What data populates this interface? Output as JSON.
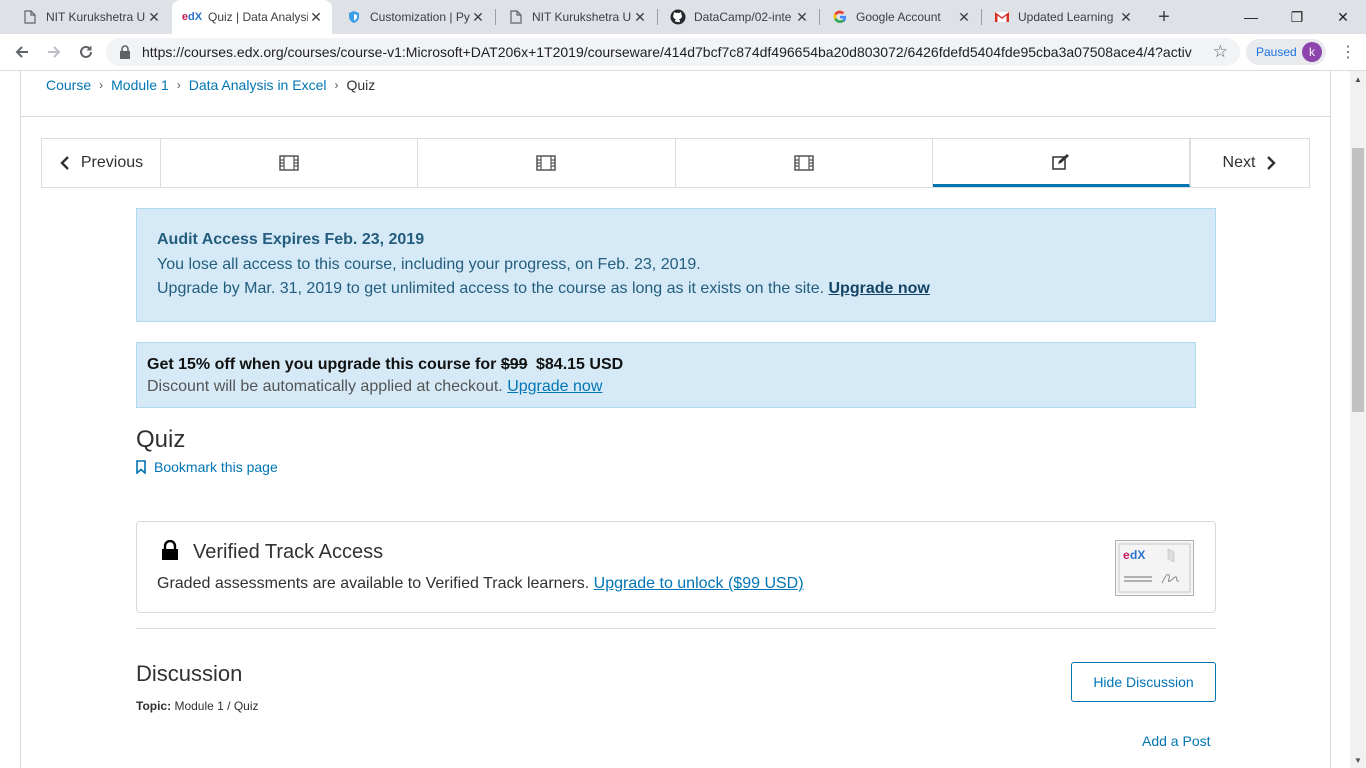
{
  "browser": {
    "tabs": [
      {
        "title": "NIT Kurukshetra U",
        "favicon": "page-icon",
        "active": false
      },
      {
        "title": "Quiz | Data Analysis",
        "favicon": "edx-icon",
        "active": true
      },
      {
        "title": "Customization | Py",
        "favicon": "shield-icon",
        "active": false
      },
      {
        "title": "NIT Kurukshetra U",
        "favicon": "page-icon",
        "active": false
      },
      {
        "title": "DataCamp/02-inte",
        "favicon": "github-icon",
        "active": false
      },
      {
        "title": "Google Account",
        "favicon": "google-icon",
        "active": false
      },
      {
        "title": "Updated Learning",
        "favicon": "gmail-icon",
        "active": false
      }
    ],
    "url": "https://courses.edx.org/courses/course-v1:Microsoft+DAT206x+1T2019/courseware/414d7bcf7c874df496654ba20d803072/6426fdefd5404fde95cba3a07508ace4/4?activ...",
    "profile_status": "Paused",
    "profile_initial": "k"
  },
  "breadcrumb": {
    "items": [
      "Course",
      "Module 1",
      "Data Analysis in Excel"
    ],
    "current": "Quiz"
  },
  "sequence_nav": {
    "previous_label": "Previous",
    "next_label": "Next",
    "units": [
      "video-icon",
      "video-icon",
      "video-icon",
      "problem-icon"
    ],
    "active_index": 3
  },
  "audit_banner": {
    "heading": "Audit Access Expires Feb. 23, 2019",
    "line1": "You lose all access to this course, including your progress, on Feb. 23, 2019.",
    "line2": "Upgrade by Mar. 31, 2019 to get unlimited access to the course as long as it exists on the site.",
    "link": "Upgrade now"
  },
  "discount_banner": {
    "heading_prefix": "Get 15% off when you upgrade this course for",
    "old_price": "$99",
    "new_price": "$84.15 USD",
    "line": "Discount will be automatically applied at checkout.",
    "link": "Upgrade now"
  },
  "unit": {
    "title": "Quiz",
    "bookmark_label": "Bookmark this page"
  },
  "verified": {
    "title": "Verified Track Access",
    "description": "Graded assessments are available to Verified Track learners.",
    "link": "Upgrade to unlock ($99 USD)",
    "cert_logo": "edX"
  },
  "discussion": {
    "title": "Discussion",
    "topic_label": "Topic:",
    "topic_value": "Module 1 / Quiz",
    "hide_button": "Hide Discussion",
    "add_post": "Add a Post"
  },
  "colors": {
    "link": "#0075b4",
    "banner_bg": "#d5eaf6",
    "banner_text": "#245d7d"
  }
}
